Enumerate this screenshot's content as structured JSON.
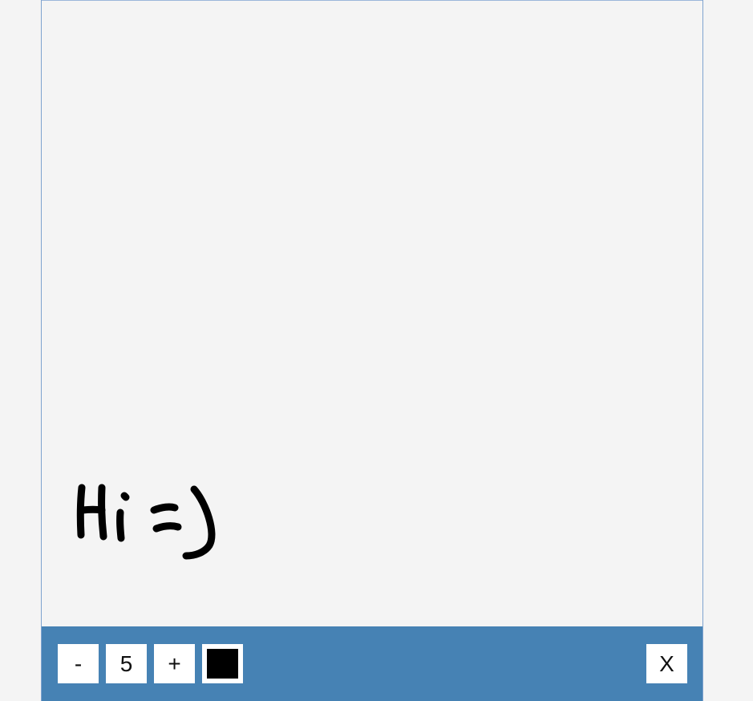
{
  "toolbar": {
    "minus_label": "-",
    "brush_size": "5",
    "plus_label": "+",
    "close_label": "X",
    "selected_color": "#000000"
  },
  "colors": {
    "toolbar_bg": "#4682b4",
    "canvas_bg": "#f4f4f4",
    "ink": "#000000"
  }
}
